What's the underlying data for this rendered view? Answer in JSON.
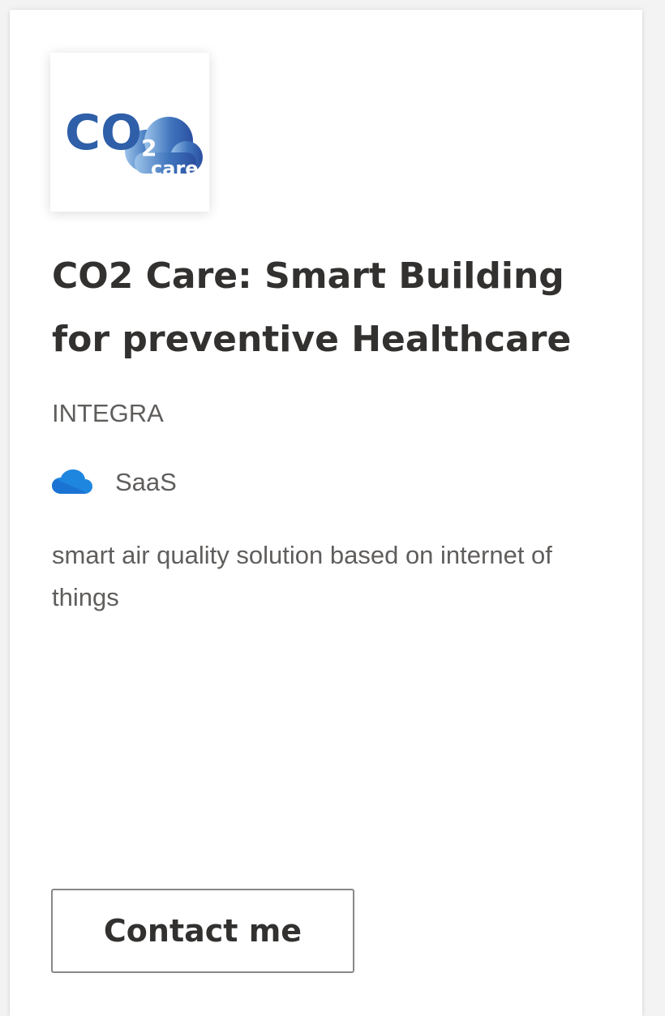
{
  "offer": {
    "title": "CO2 Care: Smart Building for preventive Healthcare",
    "publisher": "INTEGRA",
    "offer_type": "SaaS",
    "description": "smart air quality solution based on internet of things",
    "contact_button_label": "Contact me"
  },
  "logo": {
    "text_main": "CO",
    "text_sub": "2",
    "text_cloud": "care"
  },
  "icons": {
    "offer_type_icon": "cloud-icon"
  },
  "colors": {
    "logo_blue": "#2e5fa8",
    "cloud_blue": "#1f86e0",
    "title_text": "#323130",
    "secondary_text": "#605e5c",
    "button_border": "#8a8886"
  }
}
